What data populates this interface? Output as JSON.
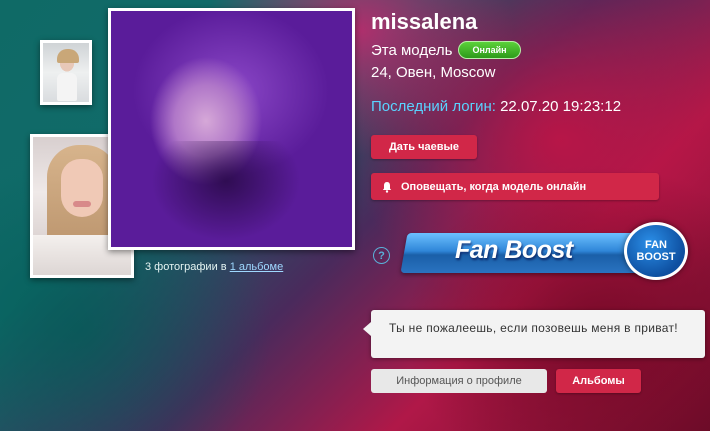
{
  "profile": {
    "username": "missalena",
    "status_label": "Эта модель",
    "online_badge": "Онлайн",
    "bio": "24, Овен, Moscow",
    "last_login_label": "Последний логин:",
    "last_login_value": "22.07.20 19:23:12"
  },
  "actions": {
    "tip": "Дать чаевые",
    "notify": "Оповещать, когда модель онлайн"
  },
  "gallery": {
    "caption_prefix": "3 фотографии в",
    "album_link": "1 альбоме"
  },
  "fanboost": {
    "label": "Fan Boost",
    "badge_line1": "FAN",
    "badge_line2": "BOOST",
    "help": "?"
  },
  "tooltip": {
    "text": "Ты не пожалеешь, если позовешь меня в приват!"
  },
  "tabs": {
    "profile_info": "Информация о профиле",
    "albums": "Альбомы"
  },
  "colors": {
    "accent_red": "#d12748",
    "online_green": "#3fb52a",
    "login_label": "#5ad3ff"
  }
}
